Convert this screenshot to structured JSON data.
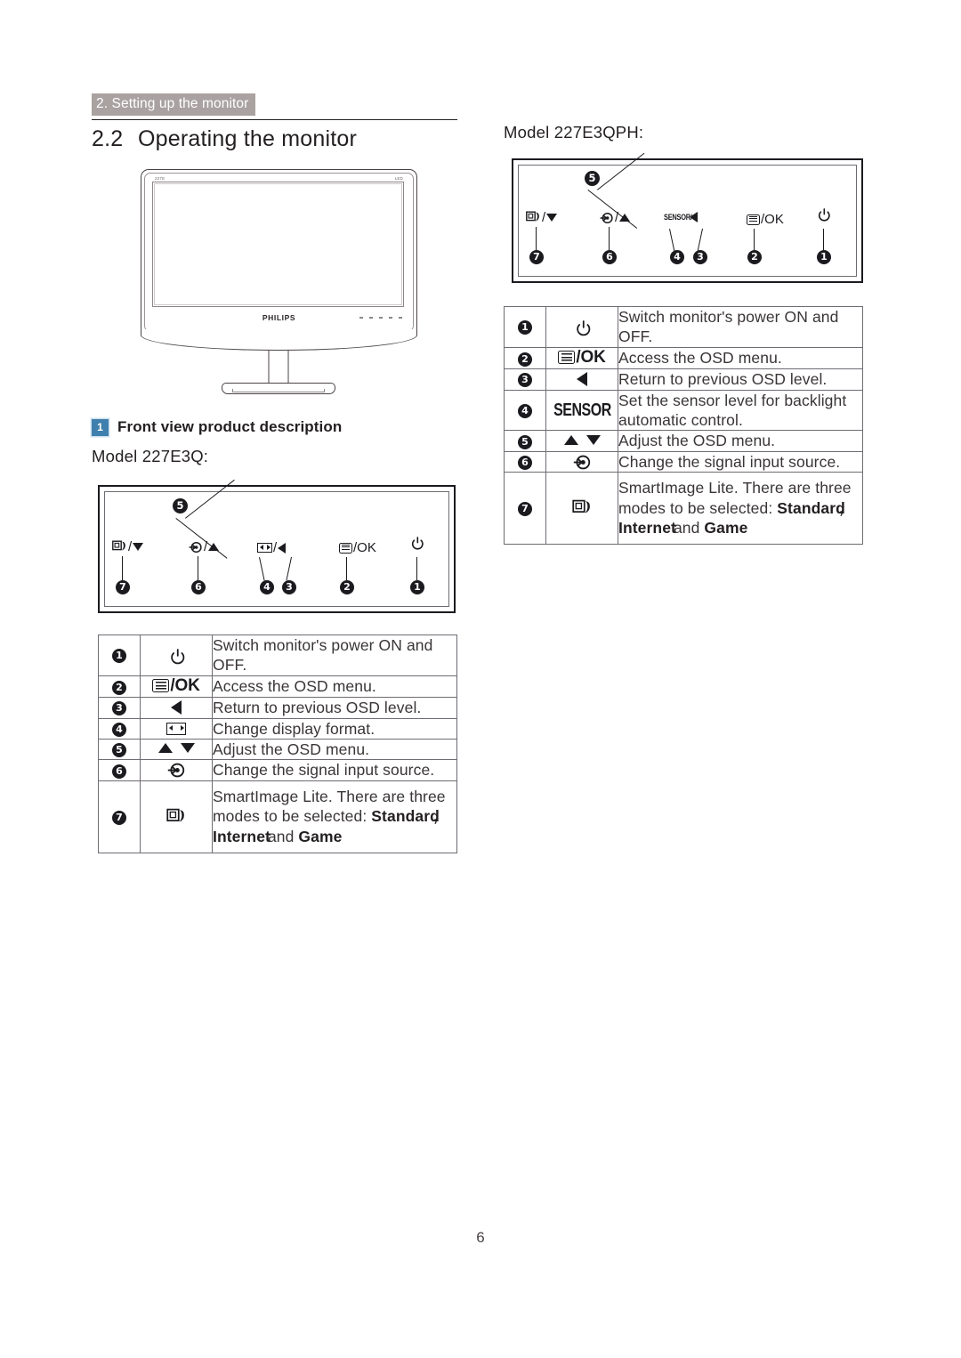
{
  "header": {
    "section_tab": "2. Setting up the monitor",
    "heading_number": "2.2",
    "heading_title": "Operating the monitor"
  },
  "monitor_image": {
    "tag_left": "227E",
    "tag_right": "LED",
    "brand": "PHILIPS"
  },
  "subsection": {
    "badge": "1",
    "title": "Front view product description"
  },
  "left_block": {
    "model_label": "Model 227E3Q:",
    "panel": {
      "callouts": [
        {
          "number": "5",
          "glyph": "up-down-arrows"
        },
        {
          "number": "7",
          "glyph": "smartimage/down"
        },
        {
          "number": "6",
          "glyph": "input/up"
        },
        {
          "number": "4",
          "glyph": "format"
        },
        {
          "number": "3",
          "glyph": "left"
        },
        {
          "number": "2",
          "glyph": "menu/OK"
        },
        {
          "number": "1",
          "glyph": "power"
        }
      ],
      "labels": {
        "smart_down": "/",
        "input_up": "/",
        "format_left": "/",
        "menu_ok": "/OK"
      }
    },
    "rows": [
      {
        "num": "1",
        "icon": "power-icon",
        "desc": "Switch monitor's power ON and OFF."
      },
      {
        "num": "2",
        "icon": "menu-ok-icon",
        "icon_text": "/OK",
        "desc": "Access the OSD menu."
      },
      {
        "num": "3",
        "icon": "left-arrow-icon",
        "desc": "Return to previous OSD level."
      },
      {
        "num": "4",
        "icon": "display-format-icon",
        "desc": "Change display format."
      },
      {
        "num": "5",
        "icon": "up-down-arrow-icon",
        "desc": "Adjust the OSD menu."
      },
      {
        "num": "6",
        "icon": "input-source-icon",
        "desc": "Change the signal input source."
      },
      {
        "num": "7",
        "icon": "smartimage-icon",
        "desc_line1": "SmartImage Lite. There are three",
        "desc_line2_pre": "modes to be selected: ",
        "desc_line2_bold": "Standard",
        "desc_line2_post": ",",
        "desc_line3_bold1": "Internet",
        "desc_line3_mid": " and ",
        "desc_line3_bold2": "Game"
      }
    ]
  },
  "right_block": {
    "model_label": "Model 227E3QPH:",
    "panel": {
      "callouts": [
        {
          "number": "5",
          "glyph": "up-down-arrows"
        },
        {
          "number": "7",
          "glyph": "smartimage/down"
        },
        {
          "number": "6",
          "glyph": "input/up"
        },
        {
          "number": "4",
          "glyph": "SENSOR"
        },
        {
          "number": "3",
          "glyph": "left"
        },
        {
          "number": "2",
          "glyph": "menu/OK"
        },
        {
          "number": "1",
          "glyph": "power"
        }
      ],
      "labels": {
        "sensor_left": "SENSOR/",
        "menu_ok": "/OK"
      }
    },
    "rows": [
      {
        "num": "1",
        "icon": "power-icon",
        "desc": "Switch monitor's power ON and OFF."
      },
      {
        "num": "2",
        "icon": "menu-ok-icon",
        "icon_text": "/OK",
        "desc": "Access the OSD menu."
      },
      {
        "num": "3",
        "icon": "left-arrow-icon",
        "desc": "Return to previous OSD level."
      },
      {
        "num": "4",
        "icon": "sensor-icon",
        "icon_text": "SENSOR",
        "desc": "Set the sensor level for backlight automatic control."
      },
      {
        "num": "5",
        "icon": "up-down-arrow-icon",
        "desc": "Adjust the OSD menu."
      },
      {
        "num": "6",
        "icon": "input-source-icon",
        "desc": "Change the signal input source."
      },
      {
        "num": "7",
        "icon": "smartimage-icon",
        "desc_line1": "SmartImage Lite. There are three",
        "desc_line2_pre": "modes to be selected: ",
        "desc_line2_bold": "Standard",
        "desc_line2_post": ",",
        "desc_line3_bold1": "Internet",
        "desc_line3_mid": " and ",
        "desc_line3_bold2": "Game"
      }
    ]
  },
  "footer": {
    "page_number": "6"
  },
  "colors": {
    "section_tab_bg": "#a9a2a0",
    "badge_bg": "#3f7fad",
    "ink": "#231f20",
    "table_border": "#6f6b72"
  }
}
